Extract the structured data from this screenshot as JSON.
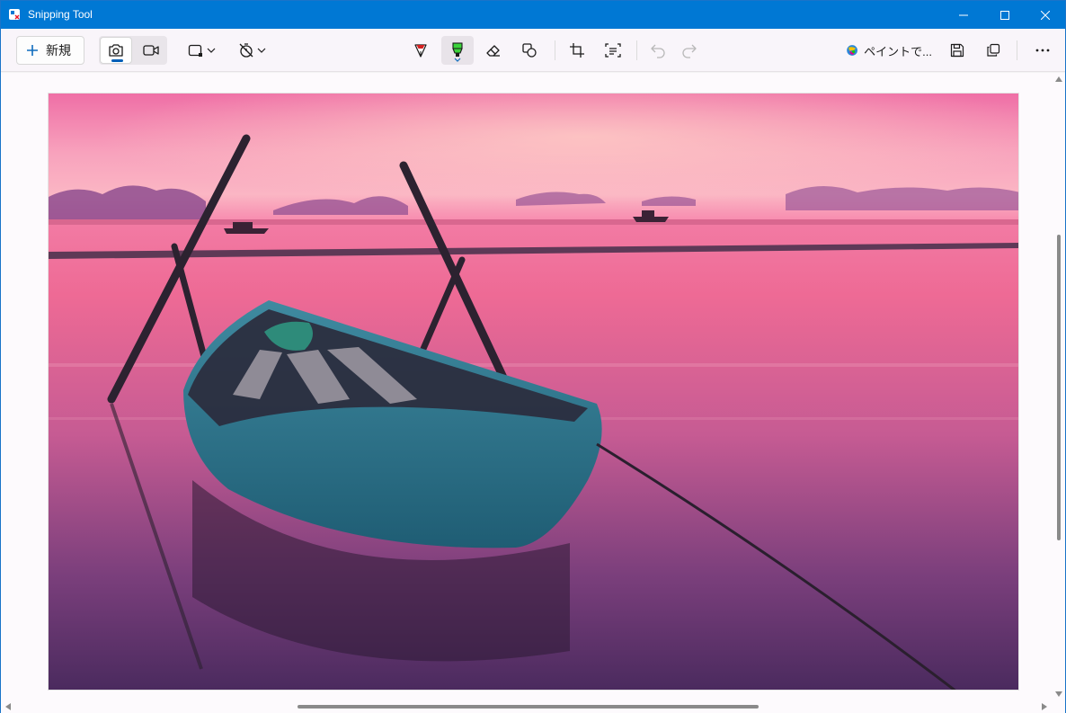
{
  "window": {
    "title": "Snipping Tool",
    "minimize_glyph": "minimize-icon",
    "maximize_glyph": "maximize-icon",
    "close_glyph": "close-icon"
  },
  "toolbar": {
    "new_label": "新規",
    "snip_mode_selected": "photo",
    "highlighter_color": "#3bd43b",
    "ballpoint_color": "#d42020",
    "open_in_paint_label": "ペイントで..."
  },
  "canvas": {
    "image_subject": "wooden-boat-at-sunset",
    "vertical_scroll_position": 0.25,
    "horizontal_scroll_position": 0.42
  }
}
